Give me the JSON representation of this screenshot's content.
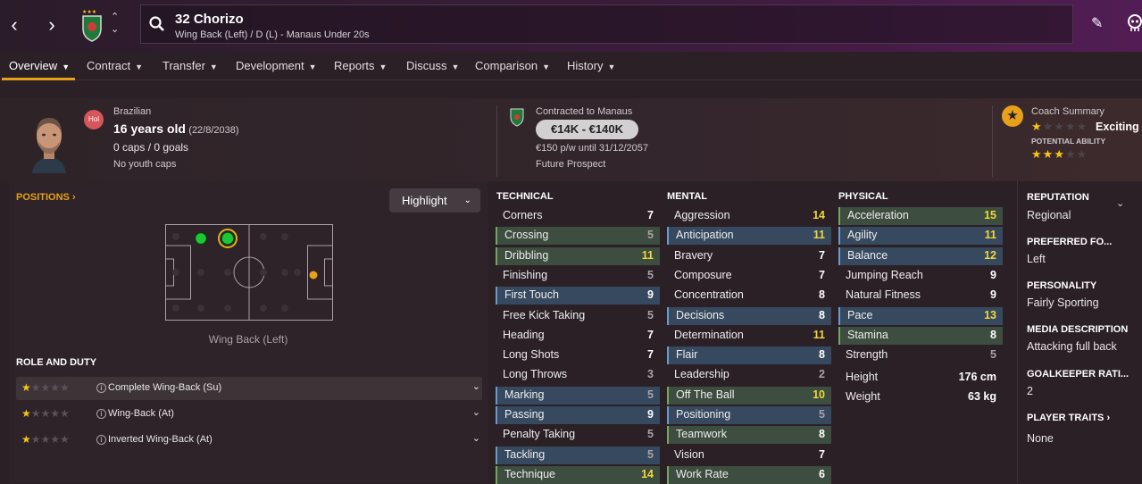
{
  "topbar": {
    "player_name": "32 Chorizo",
    "player_subtitle": "Wing Back (Left) / D (L) - Manaus Under 20s",
    "icons": [
      "back-arrow-icon",
      "forward-arrow-icon",
      "club-crest-icon",
      "up-icon",
      "down-icon",
      "search-icon",
      "edit-icon",
      "face-icon"
    ]
  },
  "tabs": [
    {
      "label": "Overview"
    },
    {
      "label": "Contract"
    },
    {
      "label": "Transfer"
    },
    {
      "label": "Development"
    },
    {
      "label": "Reports"
    },
    {
      "label": "Discuss"
    },
    {
      "label": "Comparison"
    },
    {
      "label": "History"
    }
  ],
  "header": {
    "badge": "Hol",
    "nationality": "Brazilian",
    "age": "16 years old",
    "dob": "(22/8/2038)",
    "caps": "0 caps / 0 goals",
    "youth_caps": "No youth caps",
    "contracted_to": "Contracted to Manaus",
    "value_range": "€14K - €140K",
    "wage": "€150 p/w until 31/12/2057",
    "status": "Future Prospect",
    "coach_summary_label": "Coach Summary",
    "coach_summary_value": "Exciting",
    "potential_ability_label": "POTENTIAL ABILITY",
    "current_stars": 0.5,
    "potential_stars": 2.5,
    "accent_color": "#e6a019"
  },
  "positions": {
    "title": "POSITIONS",
    "highlight_label": "Highlight",
    "role_label": "Wing Back (Left)"
  },
  "role_duty": {
    "title": "ROLE AND DUTY",
    "roles": [
      {
        "name": "Complete Wing-Back (Su)",
        "stars": 1,
        "selected": true
      },
      {
        "name": "Wing-Back (At)",
        "stars": 1,
        "selected": false
      },
      {
        "name": "Inverted Wing-Back (At)",
        "stars": 1,
        "selected": false
      }
    ]
  },
  "technical": {
    "title": "TECHNICAL",
    "attrs": [
      {
        "name": "Corners",
        "value": "7",
        "hl": ""
      },
      {
        "name": "Crossing",
        "value": "5",
        "hl": "green"
      },
      {
        "name": "Dribbling",
        "value": "11",
        "hl": "green"
      },
      {
        "name": "Finishing",
        "value": "5",
        "hl": ""
      },
      {
        "name": "First Touch",
        "value": "9",
        "hl": "blue"
      },
      {
        "name": "Free Kick Taking",
        "value": "5",
        "hl": ""
      },
      {
        "name": "Heading",
        "value": "7",
        "hl": ""
      },
      {
        "name": "Long Shots",
        "value": "7",
        "hl": ""
      },
      {
        "name": "Long Throws",
        "value": "3",
        "hl": ""
      },
      {
        "name": "Marking",
        "value": "5",
        "hl": "blue"
      },
      {
        "name": "Passing",
        "value": "9",
        "hl": "blue"
      },
      {
        "name": "Penalty Taking",
        "value": "5",
        "hl": ""
      },
      {
        "name": "Tackling",
        "value": "5",
        "hl": "blue"
      },
      {
        "name": "Technique",
        "value": "14",
        "hl": "green"
      }
    ]
  },
  "mental": {
    "title": "MENTAL",
    "attrs": [
      {
        "name": "Aggression",
        "value": "14",
        "hl": ""
      },
      {
        "name": "Anticipation",
        "value": "11",
        "hl": "blue"
      },
      {
        "name": "Bravery",
        "value": "7",
        "hl": ""
      },
      {
        "name": "Composure",
        "value": "7",
        "hl": ""
      },
      {
        "name": "Concentration",
        "value": "8",
        "hl": ""
      },
      {
        "name": "Decisions",
        "value": "8",
        "hl": "blue"
      },
      {
        "name": "Determination",
        "value": "11",
        "hl": ""
      },
      {
        "name": "Flair",
        "value": "8",
        "hl": "blue"
      },
      {
        "name": "Leadership",
        "value": "2",
        "hl": ""
      },
      {
        "name": "Off The Ball",
        "value": "10",
        "hl": "green"
      },
      {
        "name": "Positioning",
        "value": "5",
        "hl": "blue"
      },
      {
        "name": "Teamwork",
        "value": "8",
        "hl": "green"
      },
      {
        "name": "Vision",
        "value": "7",
        "hl": ""
      },
      {
        "name": "Work Rate",
        "value": "6",
        "hl": "green"
      }
    ]
  },
  "physical": {
    "title": "PHYSICAL",
    "attrs": [
      {
        "name": "Acceleration",
        "value": "15",
        "hl": "green"
      },
      {
        "name": "Agility",
        "value": "11",
        "hl": "blue"
      },
      {
        "name": "Balance",
        "value": "12",
        "hl": "blue"
      },
      {
        "name": "Jumping Reach",
        "value": "9",
        "hl": ""
      },
      {
        "name": "Natural Fitness",
        "value": "9",
        "hl": ""
      },
      {
        "name": "Pace",
        "value": "13",
        "hl": "blue"
      },
      {
        "name": "Stamina",
        "value": "8",
        "hl": "green"
      },
      {
        "name": "Strength",
        "value": "5",
        "hl": ""
      }
    ],
    "height_label": "Height",
    "height_value": "176 cm",
    "weight_label": "Weight",
    "weight_value": "63 kg"
  },
  "right_panel": {
    "reputation_label": "REPUTATION",
    "reputation_value": "Regional",
    "foot_label": "PREFERRED FO...",
    "foot_value": "Left",
    "personality_label": "PERSONALITY",
    "personality_value": "Fairly Sporting",
    "media_label": "MEDIA DESCRIPTION",
    "media_value": "Attacking full back",
    "gk_label": "GOALKEEPER RATI...",
    "gk_value": "2",
    "traits_label": "PLAYER TRAITS",
    "traits_value": "None"
  }
}
